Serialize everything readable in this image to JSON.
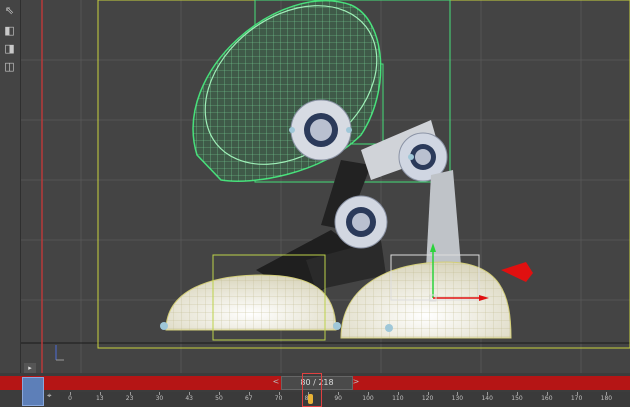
{
  "toolbar": {
    "tools": [
      {
        "icon": "select-tool-icon",
        "glyph": "⇖"
      },
      {
        "icon": "camera-add-icon",
        "glyph": "◧"
      },
      {
        "icon": "camera-target-icon",
        "glyph": "◨"
      },
      {
        "icon": "camera-record-icon",
        "glyph": "◫"
      }
    ]
  },
  "timeline": {
    "frame_display": "80 / 218",
    "prev_glyph": "<",
    "next_glyph": ">",
    "expand_glyph": "▸",
    "ticks": [
      "0",
      "13",
      "23",
      "30",
      "43",
      "50",
      "67",
      "70",
      "80",
      "90",
      "100",
      "110",
      "120",
      "130",
      "140",
      "150",
      "160",
      "170",
      "180"
    ]
  },
  "colors": {
    "viewport_bg": "#444444",
    "grid": "#575757",
    "selection_green": "#46e07a",
    "wire_green": "#7fe3a0",
    "frame_yellow": "#cfd94a",
    "gizmo_red": "#e01010",
    "base_cream": "#f3efd8",
    "metal": "#c9cfdc",
    "timebar_red": "#b51515"
  }
}
